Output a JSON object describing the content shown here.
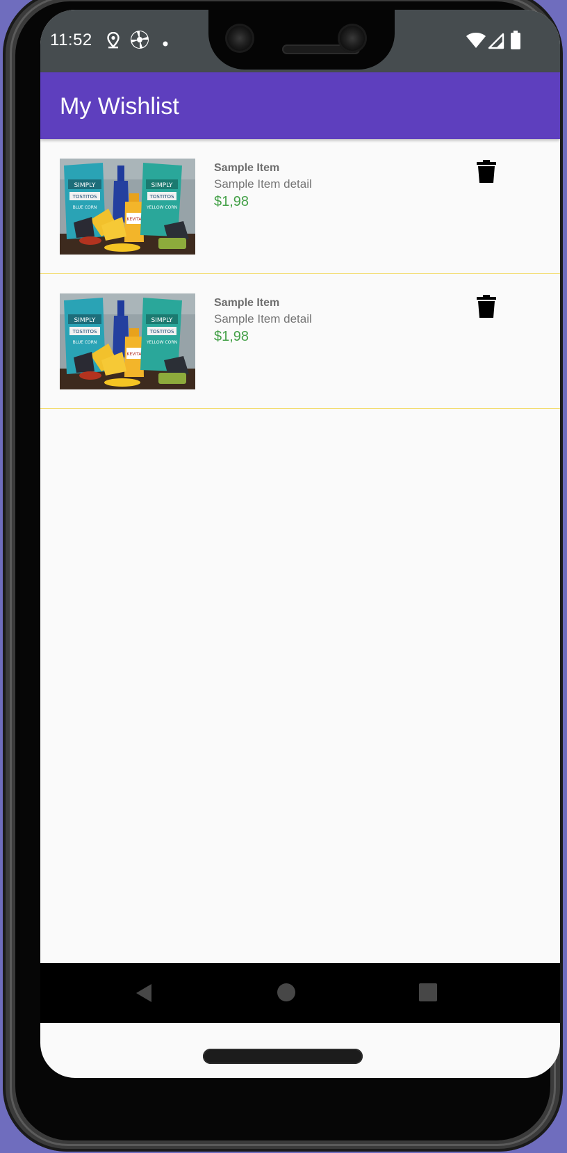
{
  "status_bar": {
    "time": "11:52",
    "icons": [
      "location-pin-icon",
      "pinwheel-icon",
      "dot-icon",
      "wifi-icon",
      "cellular-icon",
      "battery-icon"
    ]
  },
  "app_bar": {
    "title": "My Wishlist",
    "color": "#5e3fbe"
  },
  "wishlist": {
    "items": [
      {
        "name": "Sample Item",
        "detail": "Sample Item detail",
        "price": "$1,98",
        "image": "snack-products-photo",
        "action_icon": "trash-icon"
      },
      {
        "name": "Sample Item",
        "detail": "Sample Item detail",
        "price": "$1,98",
        "image": "snack-products-photo",
        "action_icon": "trash-icon"
      }
    ],
    "price_color": "#43a047",
    "divider_color": "#f3dc6e"
  },
  "navigation": {
    "buttons": [
      "back-icon",
      "home-icon",
      "recents-icon"
    ]
  }
}
